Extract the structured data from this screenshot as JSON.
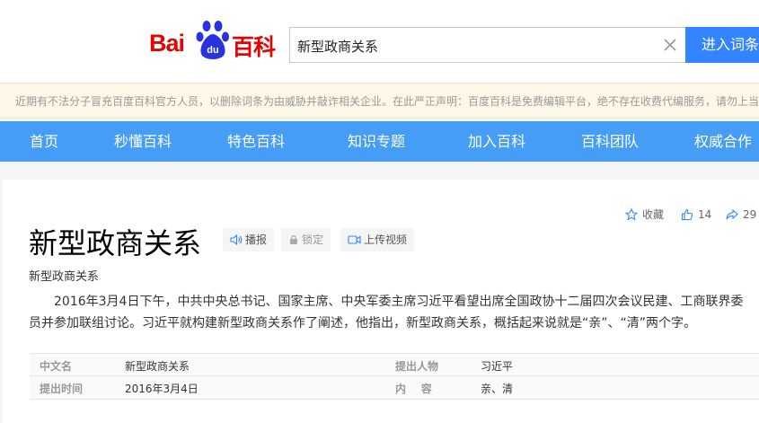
{
  "header": {
    "logo": {
      "text_bai": "Bai",
      "text_du": "du",
      "text_baike": "百科"
    },
    "search": {
      "value": "新型政商关系",
      "placeholder": ""
    },
    "search_button_label": "进入词条"
  },
  "notice": {
    "text": "近期有不法分子冒充百度百科官方人员，以删除词条为由威胁并敲诈相关企业。在此严正声明：百度百科是免费编辑平台，绝不存在收费代编服务，请勿上当受骗！"
  },
  "nav": {
    "items": [
      {
        "label": "首页"
      },
      {
        "label": "秒懂百科"
      },
      {
        "label": "特色百科"
      },
      {
        "label": "知识专题"
      },
      {
        "label": "加入百科"
      },
      {
        "label": "百科团队"
      },
      {
        "label": "权威合作"
      }
    ]
  },
  "entry": {
    "title": "新型政商关系",
    "subtitle": "新型政商关系",
    "tools": {
      "broadcast_label": "播报",
      "lock_label": "锁定",
      "upload_video_label": "上传视频"
    },
    "actions": {
      "favorite_label": "收藏",
      "like_count": "14",
      "share_count": "29"
    },
    "summary": "2016年3月4日下午，中共中央总书记、国家主席、中央军委主席习近平看望出席全国政协十二届四次会议民建、工商联界委员并参加联组讨论。习近平就构建新型政商关系作了阐述，他指出，新型政商关系，概括起来说就是“亲”、“清”两个字。",
    "info": [
      {
        "label_left": "中文名",
        "value_left": "新型政商关系",
        "label_right": "提出人物",
        "value_right": "习近平"
      },
      {
        "label_left": "提出时间",
        "value_left": "2016年3月4日",
        "label_right": "内    容",
        "value_right": "亲、清"
      }
    ]
  },
  "colors": {
    "brand_red": "#e10602",
    "brand_blue": "#2932e1",
    "nav_blue": "#459df5",
    "search_blue": "#3385ff",
    "notice_bg": "#fdf7e8"
  },
  "icons": [
    "baidu-paw-icon",
    "clear-icon",
    "star-icon",
    "thumbs-up-icon",
    "share-icon",
    "speaker-icon",
    "lock-icon",
    "video-icon"
  ]
}
